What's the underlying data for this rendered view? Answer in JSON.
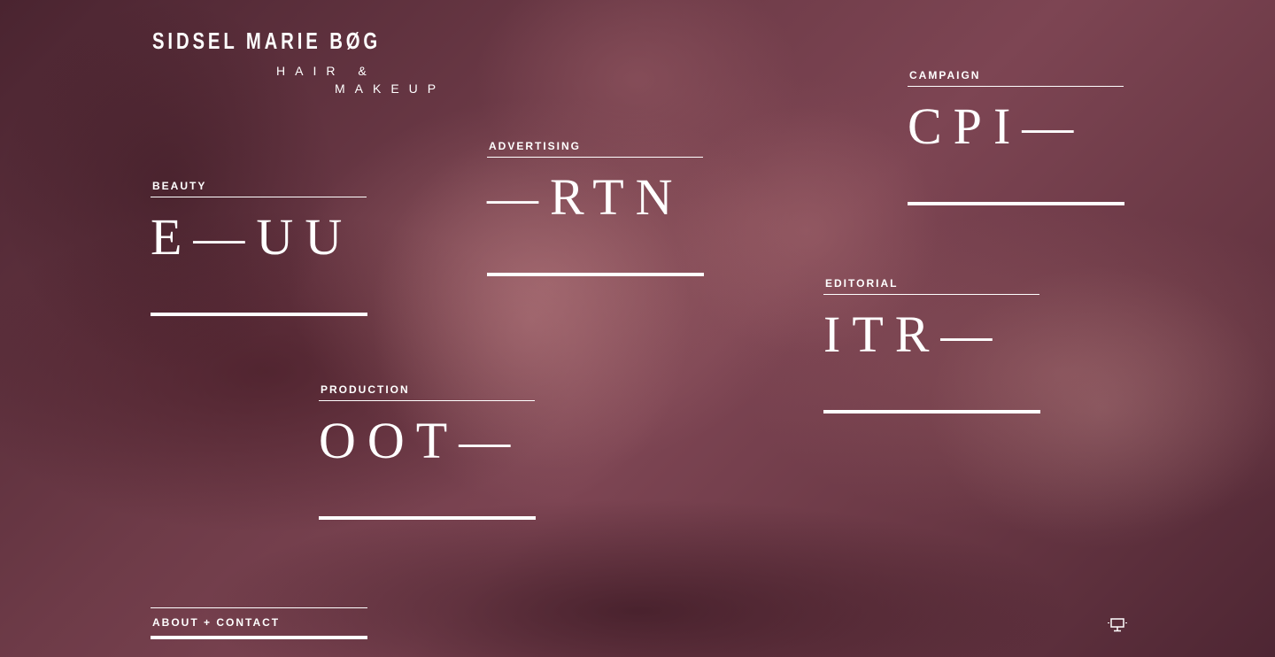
{
  "brand": {
    "name": "SIDSEL MARIE BØG",
    "line1": "HAIR &",
    "line2": "MAKEUP"
  },
  "tiles": [
    {
      "label": "BEAUTY",
      "word": "E—UU"
    },
    {
      "label": "ADVERTISING",
      "word": "—RTN"
    },
    {
      "label": "CAMPAIGN",
      "word": "CPI—"
    },
    {
      "label": "EDITORIAL",
      "word": "ITR—"
    },
    {
      "label": "PRODUCTION",
      "word": "OOT—"
    }
  ],
  "footer": {
    "about_label": "ABOUT + CONTACT"
  },
  "icons": {
    "device": "monitor-icon"
  },
  "colors": {
    "text": "#ffffff",
    "overlay": "#6e3b48"
  }
}
